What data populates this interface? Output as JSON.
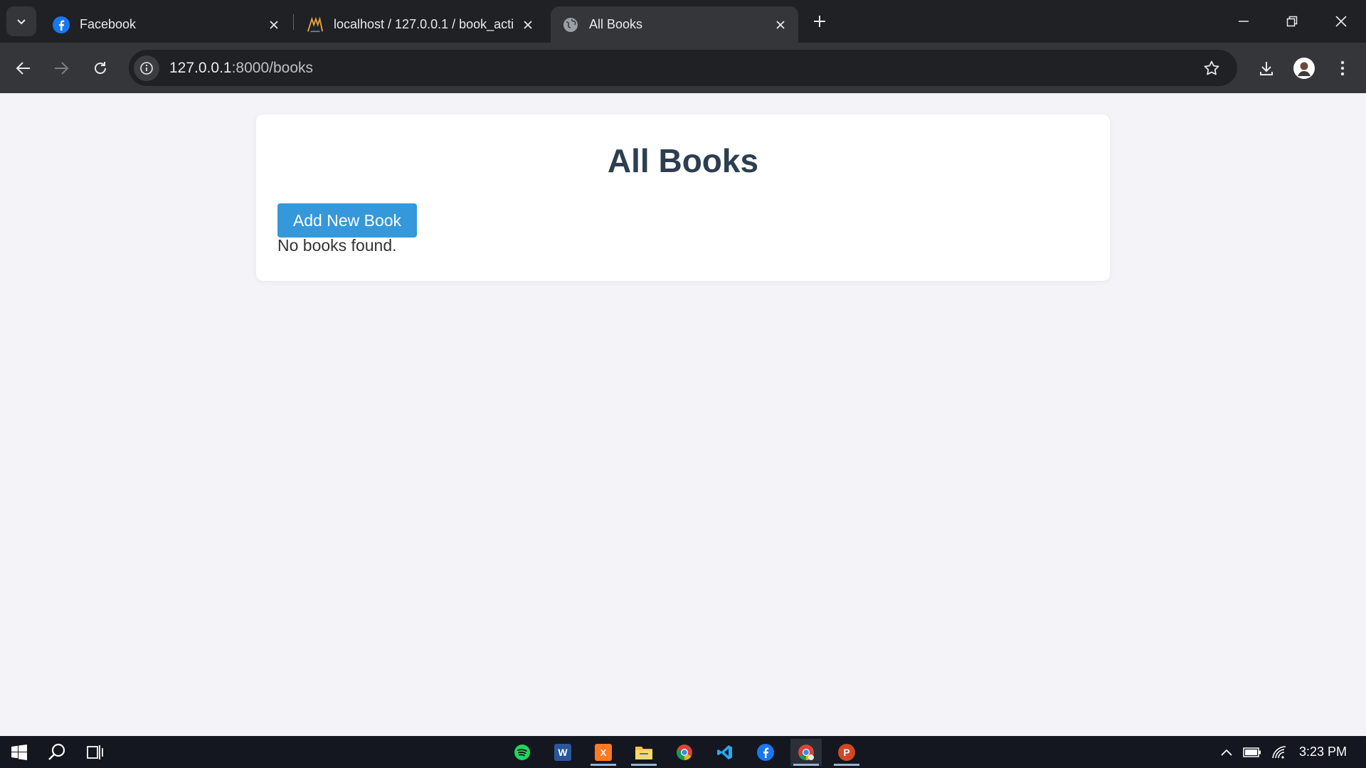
{
  "browser": {
    "tabs": [
      {
        "title": "Facebook",
        "icon": "facebook-icon",
        "active": false
      },
      {
        "title": "localhost / 127.0.0.1 / book_acti",
        "icon": "phpmyadmin-icon",
        "active": false
      },
      {
        "title": "All Books",
        "icon": "globe-icon",
        "active": true
      }
    ],
    "address": {
      "host": "127.0.0.1",
      "path": ":8000/books"
    }
  },
  "page": {
    "heading": "All Books",
    "add_button_label": "Add New Book",
    "empty_message": "No books found."
  },
  "taskbar": {
    "apps": [
      "spotify",
      "word",
      "xampp",
      "file-explorer",
      "chrome",
      "vscode",
      "facebook",
      "chrome-profile",
      "powerpoint"
    ],
    "clock": "3:23 PM"
  },
  "colors": {
    "heading": "#2c3e50",
    "button": "#3498db",
    "page_background": "#f4f4f8"
  }
}
